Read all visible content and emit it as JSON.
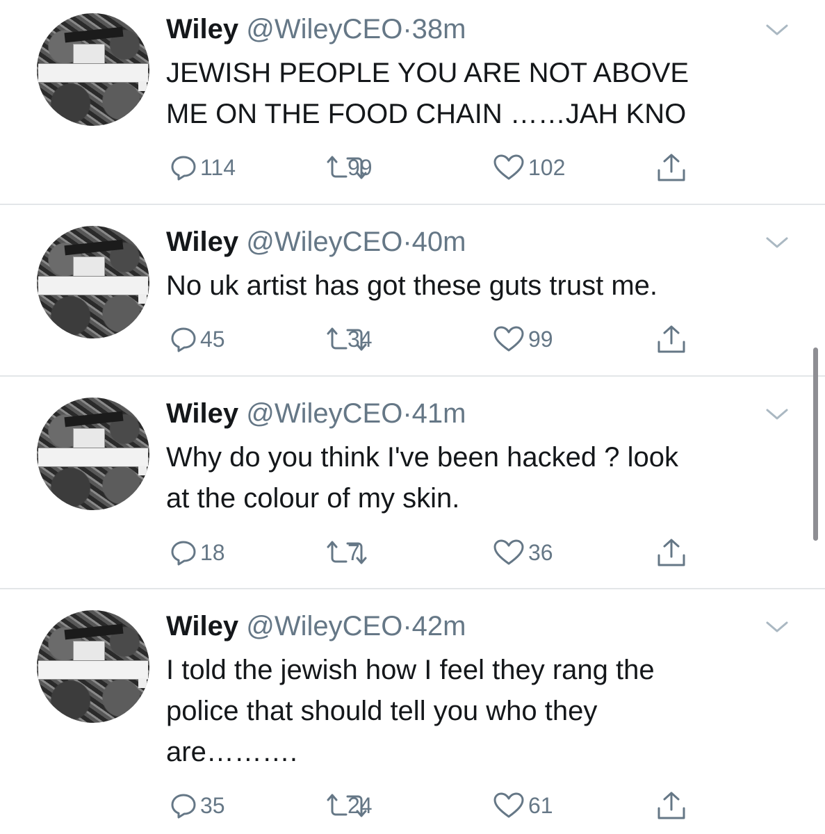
{
  "icons": {
    "menu": "chevron-down-icon",
    "reply": "reply-icon",
    "retweet": "retweet-icon",
    "like": "heart-icon",
    "share": "share-icon"
  },
  "colors": {
    "text": "#14171a",
    "secondary": "#657786",
    "divider": "#e3e6e8",
    "icon": "#657786"
  },
  "tweets": [
    {
      "name": "Wiley",
      "handle": "@WileyCEO",
      "separator": "·",
      "time": "38m",
      "lines": [
        "JEWISH PEOPLE YOU ARE NOT ABOVE",
        "ME ON THE FOOD CHAIN ……JAH KNO"
      ],
      "replies": "114",
      "retweets": "99",
      "likes": "102"
    },
    {
      "name": "Wiley",
      "handle": "@WileyCEO",
      "separator": "·",
      "time": "40m",
      "lines": [
        "No uk artist has got these guts trust me."
      ],
      "replies": "45",
      "retweets": "34",
      "likes": "99"
    },
    {
      "name": "Wiley",
      "handle": "@WileyCEO",
      "separator": "·",
      "time": "41m",
      "lines": [
        "Why do you think I've been hacked ? look",
        "at the colour of my skin."
      ],
      "replies": "18",
      "retweets": "7",
      "likes": "36"
    },
    {
      "name": "Wiley",
      "handle": "@WileyCEO",
      "separator": "·",
      "time": "42m",
      "lines": [
        "I told the jewish how I feel they rang the",
        "police that should tell you who they",
        "are………."
      ],
      "replies": "35",
      "retweets": "24",
      "likes": "61"
    }
  ]
}
